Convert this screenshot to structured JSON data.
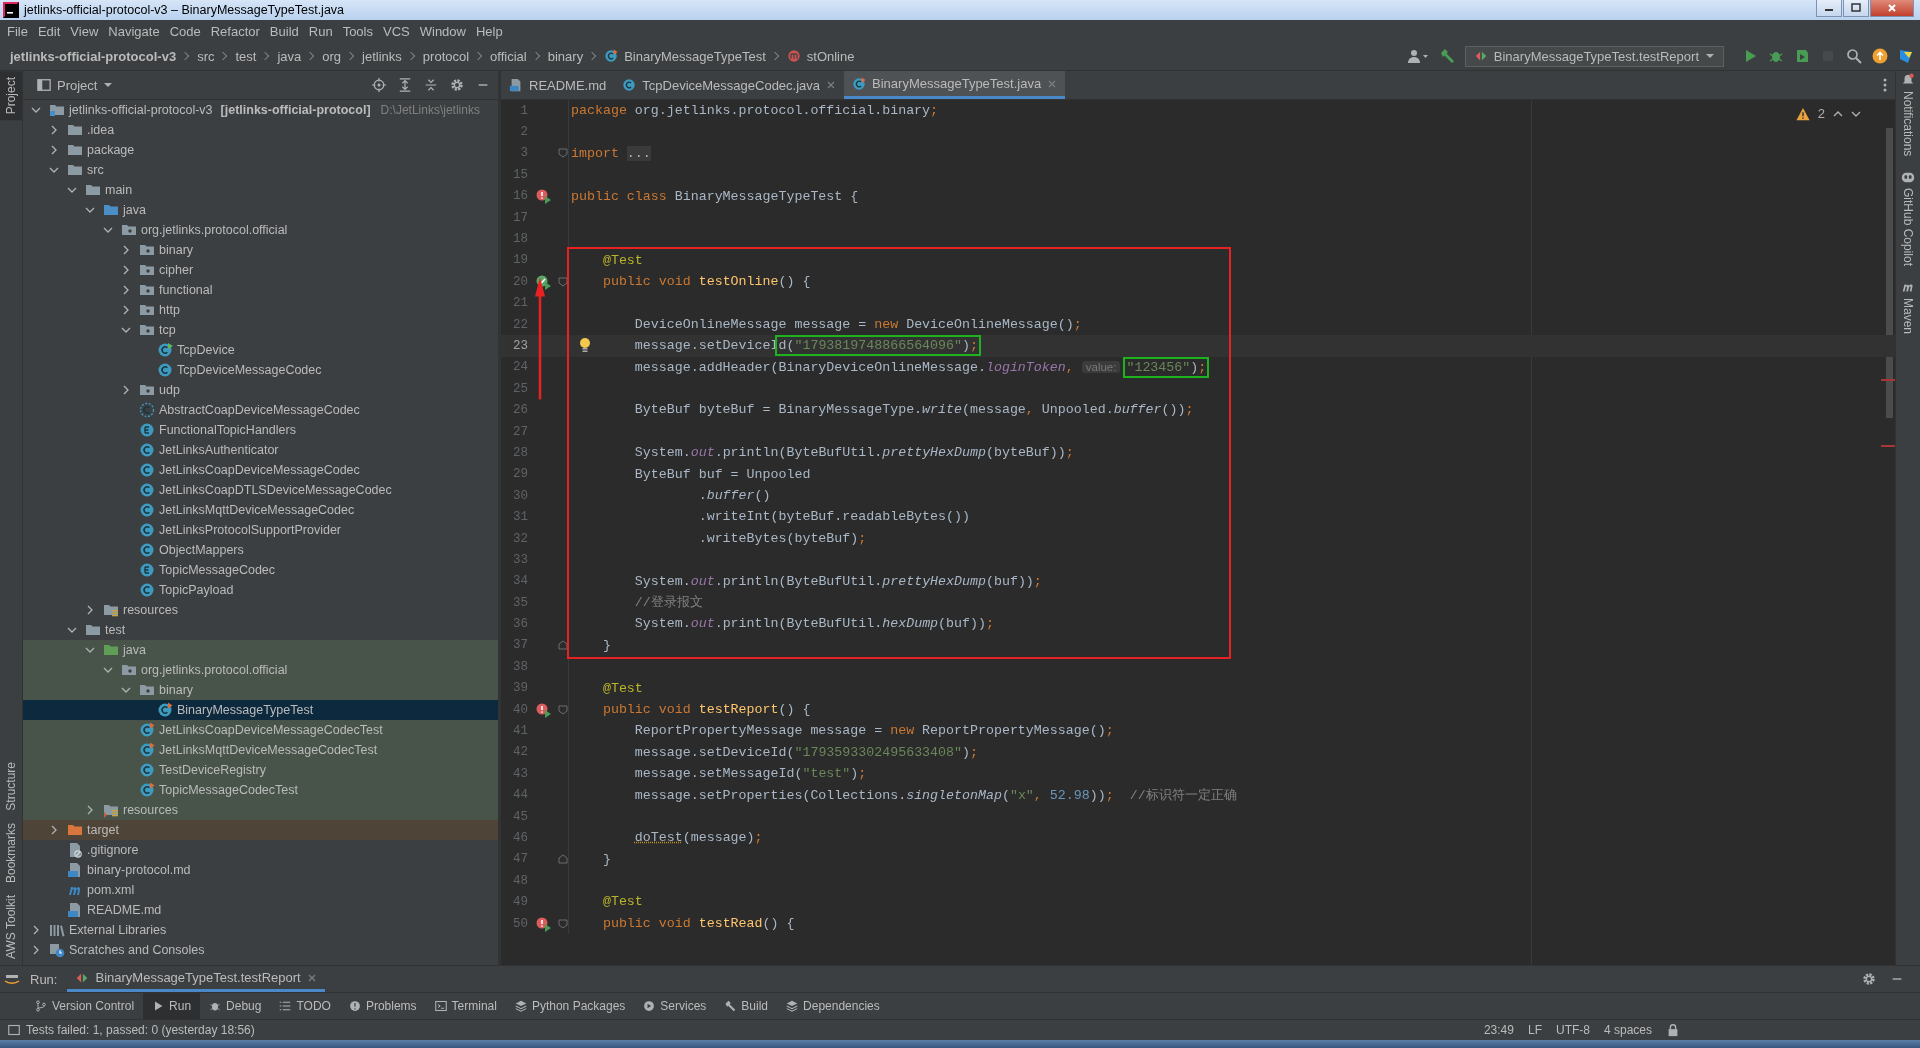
{
  "window": {
    "title": "jetlinks-official-protocol-v3 – BinaryMessageTypeTest.java"
  },
  "menu": [
    "File",
    "Edit",
    "View",
    "Navigate",
    "Code",
    "Refactor",
    "Build",
    "Run",
    "Tools",
    "VCS",
    "Window",
    "Help"
  ],
  "nav": {
    "breadcrumbs": [
      {
        "label": "jetlinks-official-protocol-v3",
        "kind": "project"
      },
      {
        "label": "src",
        "kind": "folder"
      },
      {
        "label": "test",
        "kind": "folder"
      },
      {
        "label": "java",
        "kind": "folder"
      },
      {
        "label": "org",
        "kind": "folder"
      },
      {
        "label": "jetlinks",
        "kind": "folder"
      },
      {
        "label": "protocol",
        "kind": "folder"
      },
      {
        "label": "official",
        "kind": "folder"
      },
      {
        "label": "binary",
        "kind": "folder"
      },
      {
        "label": "BinaryMessageTypeTest",
        "kind": "class"
      },
      {
        "label": "stOnline",
        "kind": "method"
      }
    ],
    "run_config": "BinaryMessageTypeTest.testReport",
    "actions": [
      {
        "kind": "run",
        "disabled": false
      },
      {
        "kind": "debug",
        "disabled": false
      },
      {
        "kind": "coverage",
        "disabled": false
      },
      {
        "kind": "stop",
        "disabled": true
      },
      {
        "kind": "search",
        "disabled": false
      },
      {
        "kind": "update",
        "disabled": false
      },
      {
        "kind": "plugin",
        "disabled": false
      }
    ]
  },
  "project": {
    "title": "Project",
    "tree": [
      {
        "label": "jetlinks-official-protocol-v3",
        "module": "[jetlinks-official-protocol]",
        "path": "D:\\JetLinks\\jetlinks",
        "kind": "module",
        "expanded": true,
        "selected": false,
        "children": [
          {
            "label": ".idea",
            "kind": "folder",
            "expanded": false,
            "selected": false
          },
          {
            "label": "package",
            "kind": "folder",
            "expanded": false,
            "selected": false
          },
          {
            "label": "src",
            "kind": "folder",
            "expanded": true,
            "selected": false,
            "children": [
              {
                "label": "main",
                "kind": "folder",
                "expanded": true,
                "selected": false,
                "children": [
                  {
                    "label": "java",
                    "kind": "src_root",
                    "expanded": true,
                    "selected": false,
                    "children": [
                      {
                        "label": "org.jetlinks.protocol.official",
                        "kind": "package",
                        "expanded": true,
                        "selected": false,
                        "children": [
                          {
                            "label": "binary",
                            "kind": "package",
                            "expanded": false,
                            "selected": false
                          },
                          {
                            "label": "cipher",
                            "kind": "package",
                            "expanded": false,
                            "selected": false
                          },
                          {
                            "label": "functional",
                            "kind": "package",
                            "expanded": false,
                            "selected": false
                          },
                          {
                            "label": "http",
                            "kind": "package",
                            "expanded": false,
                            "selected": false
                          },
                          {
                            "label": "tcp",
                            "kind": "package",
                            "expanded": true,
                            "selected": false,
                            "children": [
                              {
                                "label": "TcpDevice",
                                "kind": "class_run",
                                "selected": false
                              },
                              {
                                "label": "TcpDeviceMessageCodec",
                                "kind": "class",
                                "selected": false
                              }
                            ]
                          },
                          {
                            "label": "udp",
                            "kind": "package",
                            "expanded": false,
                            "selected": false
                          },
                          {
                            "label": "AbstractCoapDeviceMessageCodec",
                            "kind": "abstract",
                            "selected": false
                          },
                          {
                            "label": "FunctionalTopicHandlers",
                            "kind": "enum",
                            "selected": false
                          },
                          {
                            "label": "JetLinksAuthenticator",
                            "kind": "class",
                            "selected": false
                          },
                          {
                            "label": "JetLinksCoapDeviceMessageCodec",
                            "kind": "class",
                            "selected": false
                          },
                          {
                            "label": "JetLinksCoapDTLSDeviceMessageCodec",
                            "kind": "class",
                            "selected": false
                          },
                          {
                            "label": "JetLinksMqttDeviceMessageCodec",
                            "kind": "class",
                            "selected": false
                          },
                          {
                            "label": "JetLinksProtocolSupportProvider",
                            "kind": "class",
                            "selected": false
                          },
                          {
                            "label": "ObjectMappers",
                            "kind": "class",
                            "selected": false
                          },
                          {
                            "label": "TopicMessageCodec",
                            "kind": "enum",
                            "selected": false
                          },
                          {
                            "label": "TopicPayload",
                            "kind": "class",
                            "selected": false
                          }
                        ]
                      }
                    ]
                  },
                  {
                    "label": "resources",
                    "kind": "resources",
                    "expanded": false,
                    "selected": false
                  }
                ]
              },
              {
                "label": "test",
                "kind": "folder",
                "expanded": true,
                "selected": false,
                "children": [
                  {
                    "label": "java",
                    "kind": "test_root",
                    "test_scope": true,
                    "expanded": true,
                    "selected": false,
                    "children": [
                      {
                        "label": "org.jetlinks.protocol.official",
                        "kind": "package",
                        "expanded": true,
                        "selected": false,
                        "children": [
                          {
                            "label": "binary",
                            "kind": "package",
                            "expanded": true,
                            "selected": false,
                            "children": [
                              {
                                "label": "BinaryMessageTypeTest",
                                "kind": "test_class",
                                "selected": true
                              }
                            ]
                          },
                          {
                            "label": "JetLinksCoapDeviceMessageCodecTest",
                            "kind": "test_class",
                            "selected": false
                          },
                          {
                            "label": "JetLinksMqttDeviceMessageCodecTest",
                            "kind": "test_class",
                            "selected": false
                          },
                          {
                            "label": "TestDeviceRegistry",
                            "kind": "class",
                            "selected": false
                          },
                          {
                            "label": "TopicMessageCodecTest",
                            "kind": "test_class",
                            "selected": false
                          }
                        ]
                      }
                    ]
                  },
                  {
                    "label": "resources",
                    "kind": "test_resources",
                    "test_scope": true,
                    "expanded": false,
                    "selected": false
                  }
                ]
              }
            ]
          },
          {
            "label": "target",
            "kind": "excluded",
            "excluded": true,
            "expanded": false,
            "selected": false
          },
          {
            "label": ".gitignore",
            "kind": "gitignore",
            "selected": false
          },
          {
            "label": "binary-protocol.md",
            "kind": "md",
            "selected": false
          },
          {
            "label": "pom.xml",
            "kind": "maven",
            "selected": false
          },
          {
            "label": "README.md",
            "kind": "md",
            "selected": false
          }
        ]
      },
      {
        "label": "External Libraries",
        "kind": "libraries",
        "expanded": false,
        "selected": false
      },
      {
        "label": "Scratches and Consoles",
        "kind": "scratches",
        "expanded": false,
        "selected": false
      }
    ]
  },
  "left_stripe": [
    {
      "label": "Project",
      "selected": true
    },
    {
      "label": "Structure",
      "selected": false
    },
    {
      "label": "Bookmarks",
      "selected": false
    },
    {
      "label": "AWS Toolkit",
      "selected": false
    }
  ],
  "right_stripe": [
    {
      "label": "Notifications",
      "kind": "bell"
    },
    {
      "label": "GitHub Copilot",
      "kind": "copilot"
    },
    {
      "label": "Maven",
      "kind": "maven"
    }
  ],
  "editor": {
    "tabs": [
      {
        "label": "README.md",
        "kind": "md",
        "closable": false,
        "selected": false
      },
      {
        "label": "TcpDeviceMessageCodec.java",
        "kind": "class",
        "closable": true,
        "selected": false
      },
      {
        "label": "BinaryMessageTypeTest.java",
        "kind": "test_class",
        "closable": true,
        "selected": true
      }
    ],
    "warnings": "2",
    "lines": [
      {
        "number": "1",
        "tokens": [
          {
            "kind": "kw",
            "text": "package "
          },
          {
            "kind": "plain",
            "text": "org.jetlinks.protocol.official.binary"
          },
          {
            "kind": "kw",
            "text": ";"
          }
        ]
      },
      {
        "number": "2"
      },
      {
        "number": "3",
        "fold_start": true,
        "tokens": [
          {
            "kind": "kw",
            "text": "import "
          },
          {
            "kind": "folded",
            "text": "..."
          }
        ]
      },
      {
        "number": "15"
      },
      {
        "number": "16",
        "run_icon": true,
        "passed": false,
        "tokens": [
          {
            "kind": "kw",
            "text": "public class "
          },
          {
            "kind": "plain",
            "text": "BinaryMessageTypeTest {"
          }
        ]
      },
      {
        "number": "17"
      },
      {
        "number": "18"
      },
      {
        "number": "19",
        "frame_start": true,
        "tokens": [
          {
            "kind": "ann",
            "text": "    @Test"
          }
        ]
      },
      {
        "number": "20",
        "arrow_head": true,
        "run_icon": true,
        "passed": true,
        "fold_start": true,
        "tokens": [
          {
            "kind": "kw",
            "text": "    public void "
          },
          {
            "kind": "decl",
            "text": "testOnline"
          },
          {
            "kind": "plain",
            "text": "() {"
          }
        ]
      },
      {
        "number": "21"
      },
      {
        "number": "22",
        "tokens": [
          {
            "kind": "plain",
            "text": "        DeviceOnlineMessage message = "
          },
          {
            "kind": "kw",
            "text": "new "
          },
          {
            "kind": "plain",
            "text": "DeviceOnlineMessage()"
          },
          {
            "kind": "kw",
            "text": ";"
          }
        ]
      },
      {
        "number": "23",
        "current": true,
        "bulb": true,
        "tokens": [
          {
            "kind": "plain",
            "text": "        message.setDeviceI"
          },
          {
            "boxed": true,
            "tokens": [
              {
                "kind": "plain",
                "text": "d("
              },
              {
                "kind": "str",
                "text": "\"1793819748866564096\""
              },
              {
                "kind": "plain",
                "text": ")"
              },
              {
                "kind": "kw",
                "text": ";"
              }
            ]
          }
        ]
      },
      {
        "number": "24",
        "tokens": [
          {
            "kind": "plain",
            "text": "        message.addHeader(BinaryDeviceOnlineMessage."
          },
          {
            "kind": "field",
            "text": "loginToken"
          },
          {
            "kind": "kw",
            "text": ","
          },
          {
            "kind": "hint",
            "text": "value:"
          },
          {
            "boxed": true,
            "tokens": [
              {
                "kind": "str",
                "text": "\"123456\""
              },
              {
                "kind": "plain",
                "text": ")"
              },
              {
                "kind": "kw",
                "text": ";"
              }
            ]
          }
        ]
      },
      {
        "number": "25",
        "arrow_tail": true
      },
      {
        "number": "26",
        "tokens": [
          {
            "kind": "plain",
            "text": "        ByteBuf byteBuf = BinaryMessageType."
          },
          {
            "kind": "static",
            "text": "write"
          },
          {
            "kind": "plain",
            "text": "(message"
          },
          {
            "kind": "kw",
            "text": ","
          },
          {
            "kind": "plain",
            "text": " Unpooled."
          },
          {
            "kind": "static",
            "text": "buffer"
          },
          {
            "kind": "plain",
            "text": "())"
          },
          {
            "kind": "kw",
            "text": ";"
          }
        ]
      },
      {
        "number": "27"
      },
      {
        "number": "28",
        "tokens": [
          {
            "kind": "plain",
            "text": "        System."
          },
          {
            "kind": "field",
            "text": "out"
          },
          {
            "kind": "plain",
            "text": ".println(ByteBufUtil."
          },
          {
            "kind": "static",
            "text": "prettyHexDump"
          },
          {
            "kind": "plain",
            "text": "(byteBuf))"
          },
          {
            "kind": "kw",
            "text": ";"
          }
        ]
      },
      {
        "number": "29",
        "tokens": [
          {
            "kind": "plain",
            "text": "        ByteBuf buf = Unpooled"
          }
        ]
      },
      {
        "number": "30",
        "tokens": [
          {
            "kind": "plain",
            "text": "                ."
          },
          {
            "kind": "static",
            "text": "buffer"
          },
          {
            "kind": "plain",
            "text": "()"
          }
        ]
      },
      {
        "number": "31",
        "tokens": [
          {
            "kind": "plain",
            "text": "                .writeInt(byteBuf.readableBytes())"
          }
        ]
      },
      {
        "number": "32",
        "tokens": [
          {
            "kind": "plain",
            "text": "                .writeBytes(byteBuf)"
          },
          {
            "kind": "kw",
            "text": ";"
          }
        ]
      },
      {
        "number": "33"
      },
      {
        "number": "34",
        "tokens": [
          {
            "kind": "plain",
            "text": "        System."
          },
          {
            "kind": "field",
            "text": "out"
          },
          {
            "kind": "plain",
            "text": ".println(ByteBufUtil."
          },
          {
            "kind": "static",
            "text": "prettyHexDump"
          },
          {
            "kind": "plain",
            "text": "(buf))"
          },
          {
            "kind": "kw",
            "text": ";"
          }
        ]
      },
      {
        "number": "35",
        "tokens": [
          {
            "kind": "comment",
            "text": "        //登录报文"
          }
        ]
      },
      {
        "number": "36",
        "tokens": [
          {
            "kind": "plain",
            "text": "        System."
          },
          {
            "kind": "field",
            "text": "out"
          },
          {
            "kind": "plain",
            "text": ".println(ByteBufUtil."
          },
          {
            "kind": "static",
            "text": "hexDump"
          },
          {
            "kind": "plain",
            "text": "(buf))"
          },
          {
            "kind": "kw",
            "text": ";"
          }
        ]
      },
      {
        "number": "37",
        "frame_end": true,
        "fold_end": true,
        "tokens": [
          {
            "kind": "plain",
            "text": "    }"
          }
        ]
      },
      {
        "number": "38"
      },
      {
        "number": "39",
        "tokens": [
          {
            "kind": "ann",
            "text": "    @Test"
          }
        ]
      },
      {
        "number": "40",
        "run_icon": true,
        "passed": false,
        "fold_start": true,
        "tokens": [
          {
            "kind": "kw",
            "text": "    public void "
          },
          {
            "kind": "decl",
            "text": "testReport"
          },
          {
            "kind": "plain",
            "text": "() {"
          }
        ]
      },
      {
        "number": "41",
        "tokens": [
          {
            "kind": "plain",
            "text": "        ReportPropertyMessage message = "
          },
          {
            "kind": "kw",
            "text": "new "
          },
          {
            "kind": "plain",
            "text": "ReportPropertyMessage()"
          },
          {
            "kind": "kw",
            "text": ";"
          }
        ]
      },
      {
        "number": "42",
        "tokens": [
          {
            "kind": "plain",
            "text": "        message.setDeviceId("
          },
          {
            "kind": "str",
            "text": "\"1793593302495633408\""
          },
          {
            "kind": "plain",
            "text": ")"
          },
          {
            "kind": "kw",
            "text": ";"
          }
        ]
      },
      {
        "number": "43",
        "tokens": [
          {
            "kind": "plain",
            "text": "        message.setMessageId("
          },
          {
            "kind": "str",
            "text": "\"test\""
          },
          {
            "kind": "plain",
            "text": ")"
          },
          {
            "kind": "kw",
            "text": ";"
          }
        ]
      },
      {
        "number": "44",
        "tokens": [
          {
            "kind": "plain",
            "text": "        message.setProperties(Collections."
          },
          {
            "kind": "static",
            "text": "singletonMap"
          },
          {
            "kind": "plain",
            "text": "("
          },
          {
            "kind": "str",
            "text": "\"x\""
          },
          {
            "kind": "kw",
            "text": ", "
          },
          {
            "kind": "num",
            "text": "52.98"
          },
          {
            "kind": "plain",
            "text": "))"
          },
          {
            "kind": "kw",
            "text": ";"
          },
          {
            "kind": "comment",
            "text": "  //标识符一定正确"
          }
        ]
      },
      {
        "number": "45"
      },
      {
        "number": "46",
        "tokens": [
          {
            "kind": "warn",
            "text": "        doTest"
          },
          {
            "kind": "plain",
            "text": "(message)"
          },
          {
            "kind": "kw",
            "text": ";"
          }
        ]
      },
      {
        "number": "47",
        "fold_end": true,
        "tokens": [
          {
            "kind": "plain",
            "text": "    }"
          }
        ]
      },
      {
        "number": "48"
      },
      {
        "number": "49",
        "tokens": [
          {
            "kind": "ann",
            "text": "    @Test"
          }
        ]
      },
      {
        "number": "50",
        "run_icon": true,
        "passed": false,
        "fold_start": true,
        "tokens": [
          {
            "kind": "kw",
            "text": "    public void "
          },
          {
            "kind": "decl",
            "text": "testRead"
          },
          {
            "kind": "plain",
            "text": "() {"
          }
        ]
      }
    ]
  },
  "run_bar": {
    "label": "Run:",
    "tab": "BinaryMessageTypeTest.testReport"
  },
  "tool_tabs": [
    {
      "label": "Version Control",
      "kind": "vcs",
      "selected": false
    },
    {
      "label": "Run",
      "kind": "run",
      "selected": true
    },
    {
      "label": "Debug",
      "kind": "debug",
      "selected": false
    },
    {
      "label": "TODO",
      "kind": "todo",
      "selected": false
    },
    {
      "label": "Problems",
      "kind": "problems",
      "selected": false
    },
    {
      "label": "Terminal",
      "kind": "terminal",
      "selected": false
    },
    {
      "label": "Python Packages",
      "kind": "packages",
      "selected": false
    },
    {
      "label": "Services",
      "kind": "services",
      "selected": false
    },
    {
      "label": "Build",
      "kind": "build",
      "selected": false
    },
    {
      "label": "Dependencies",
      "kind": "packages",
      "selected": false
    }
  ],
  "status_bar": {
    "message": "Tests failed: 1, passed: 0 (yesterday 18:56)",
    "items": [
      "23:49",
      "LF",
      "UTF-8",
      "4 spaces"
    ]
  }
}
